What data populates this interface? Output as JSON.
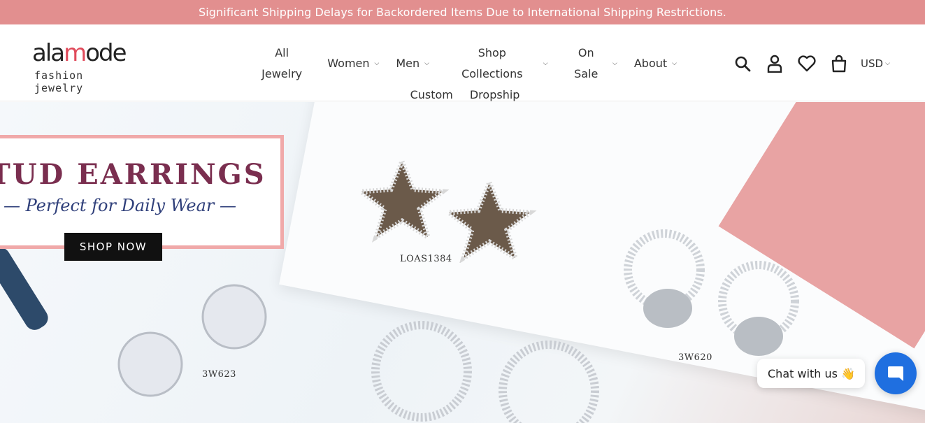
{
  "announcement": "Significant Shipping Delays for Backordered Items Due to International Shipping Restrictions.",
  "logo": {
    "word_a": "ala",
    "word_ring": "m",
    "word_b": "ode",
    "sub": "fashion jewelry"
  },
  "nav": {
    "items": [
      {
        "label": "All Jewelry",
        "dropdown": false
      },
      {
        "label": "Women",
        "dropdown": true
      },
      {
        "label": "Men",
        "dropdown": true
      },
      {
        "label": "Shop Collections",
        "dropdown": true
      },
      {
        "label": "On Sale",
        "dropdown": true
      },
      {
        "label": "About",
        "dropdown": true
      },
      {
        "label": "Custom",
        "dropdown": false
      },
      {
        "label": "Dropship",
        "dropdown": false
      }
    ]
  },
  "tools": {
    "currency": "USD"
  },
  "hero": {
    "title": "TUD EARRINGS",
    "tagline": "— Perfect for Daily Wear —",
    "button": "SHOP NOW",
    "codes": [
      "LOAS1384",
      "3W620",
      "3W623"
    ]
  },
  "chat": {
    "label": "Chat with us",
    "emoji": "👋"
  },
  "colors": {
    "announce_bg": "#e28f8f",
    "banner_border": "#f0a9a9",
    "title": "#7a2e4f",
    "chat_blue": "#1f6fe0"
  }
}
